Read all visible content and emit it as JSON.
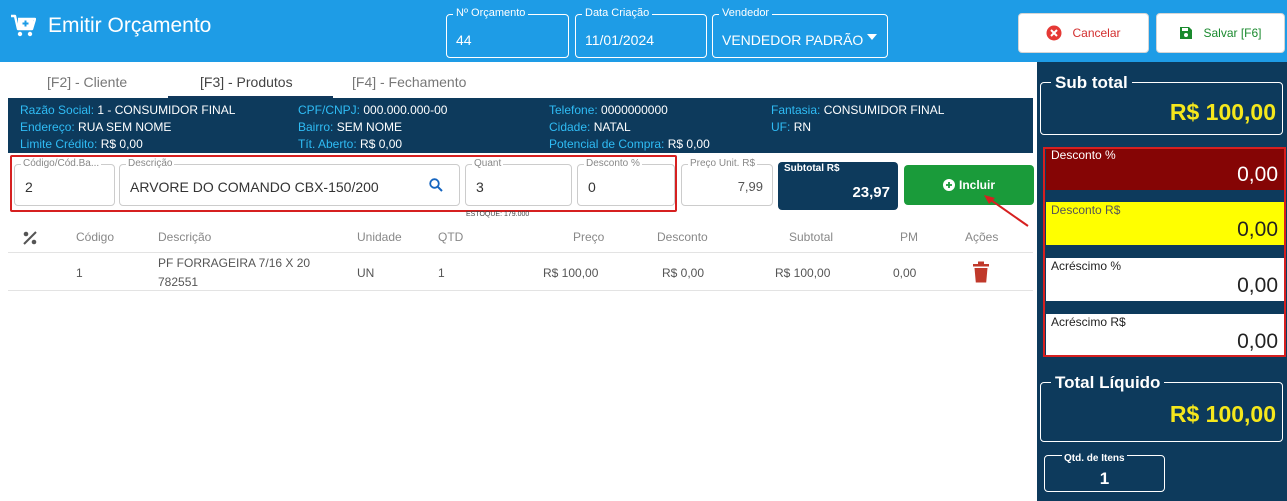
{
  "header": {
    "title": "Emitir Orçamento",
    "num_orcamento_label": "Nº Orçamento",
    "num_orcamento": "44",
    "data_criacao_label": "Data Criação",
    "data_criacao": "11/01/2024",
    "vendedor_label": "Vendedor",
    "vendedor": "VENDEDOR PADRÃO",
    "cancel_label": "Cancelar",
    "save_label": "Salvar [F6]"
  },
  "tabs": [
    {
      "label": "[F2] - Cliente"
    },
    {
      "label": "[F3] - Produtos"
    },
    {
      "label": "[F4] - Fechamento"
    }
  ],
  "active_tab": "[F3] - Produtos",
  "client": {
    "razao_social_label": "Razão Social:",
    "razao_social": "1 - CONSUMIDOR FINAL",
    "cpf_label": "CPF/CNPJ:",
    "cpf": "000.000.000-00",
    "telefone_label": "Telefone:",
    "telefone": "0000000000",
    "fantasia_label": "Fantasia:",
    "fantasia": "CONSUMIDOR FINAL",
    "endereco_label": "Endereço:",
    "endereco": "RUA SEM NOME",
    "bairro_label": "Bairro:",
    "bairro": "SEM NOME",
    "cidade_label": "Cidade:",
    "cidade": "NATAL",
    "uf_label": "UF:",
    "uf": "RN",
    "limite_label": "Limite Crédito:",
    "limite": "R$ 0,00",
    "tit_aberto_label": "Tít. Aberto:",
    "tit_aberto": "R$ 0,00",
    "potencial_label": "Potencial de Compra:",
    "potencial": "R$ 0,00"
  },
  "product_form": {
    "codigo_label": "Código/Cód.Ba...",
    "codigo": "2",
    "descricao_label": "Descrição",
    "descricao": "ARVORE DO COMANDO CBX-150/200",
    "quant_label": "Quant",
    "quant": "3",
    "desconto_label": "Desconto %",
    "desconto": "0",
    "preco_label": "Preço Unit. R$",
    "preco": "7,99",
    "subtotal_label": "Subtotal R$",
    "subtotal": "23,97",
    "estoque": "ESTOQUE: 179.000",
    "incluir_label": "Incluir"
  },
  "table": {
    "headers": [
      "Código",
      "Descrição",
      "Unidade",
      "QTD",
      "Preço",
      "Desconto",
      "Subtotal",
      "PM",
      "Ações"
    ],
    "rows": [
      {
        "codigo": "1",
        "descricao_l1": "PF FORRAGEIRA 7/16 X 20",
        "descricao_l2": "782551",
        "unidade": "UN",
        "qtd": "1",
        "preco": "R$ 100,00",
        "desconto": "R$ 0,00",
        "subtotal": "R$ 100,00",
        "pm": "0,00"
      }
    ]
  },
  "summary": {
    "subtotal_label": "Sub total",
    "subtotal": "R$ 100,00",
    "desconto_pct_label": "Desconto %",
    "desconto_pct": "0,00",
    "desconto_rs_label": "Desconto R$",
    "desconto_rs": "0,00",
    "acrescimo_pct_label": "Acréscimo %",
    "acrescimo_pct": "0,00",
    "acrescimo_rs_label": "Acréscimo R$",
    "acrescimo_rs": "0,00",
    "total_label": "Total Líquido",
    "total": "R$ 100,00",
    "qtd_itens_label": "Qtd. de Itens",
    "qtd_itens": "1"
  },
  "colors": {
    "header_bg": "#1e9ce6",
    "navy": "#0d3a5c",
    "accent_text": "#2fbcf5",
    "total_yellow": "#f5e71c",
    "discount_pct_bg": "#850505",
    "discount_rs_bg": "#ffff00",
    "incluir_green": "#1a9b3a",
    "cancel_red": "#d32f2f",
    "highlight_red": "#d62020"
  },
  "icons": [
    "cart-plus-icon",
    "search-icon",
    "plus-circle-icon",
    "trash-icon",
    "percent-icon",
    "cancel-icon",
    "save-icon",
    "chevron-down-icon"
  ]
}
